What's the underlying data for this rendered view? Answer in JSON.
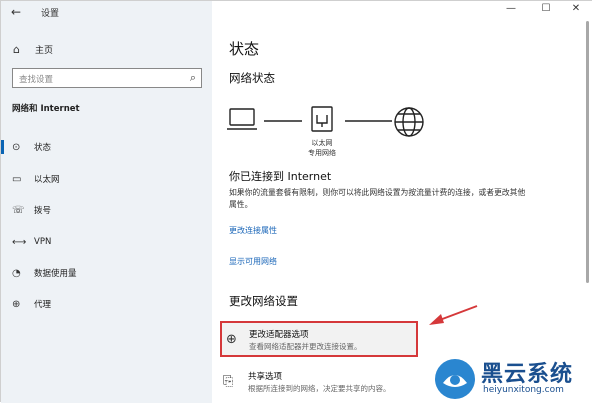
{
  "window": {
    "title": "设置",
    "back_glyph": "←",
    "minimize_glyph": "—",
    "maximize_glyph": "☐",
    "close_glyph": "✕"
  },
  "sidebar": {
    "home": {
      "icon": "home-icon",
      "glyph": "⌂",
      "label": "主页"
    },
    "search": {
      "placeholder": "查找设置",
      "icon": "search-icon",
      "glyph": "⌕"
    },
    "section_title": "网络和 Internet",
    "items": [
      {
        "icon": "status-icon",
        "glyph": "⊙",
        "label": "状态",
        "selected": true
      },
      {
        "icon": "ethernet-icon",
        "glyph": "▭",
        "label": "以太网",
        "selected": false
      },
      {
        "icon": "dialup-icon",
        "glyph": "☏",
        "label": "拨号",
        "selected": false
      },
      {
        "icon": "vpn-icon",
        "glyph": "⟷",
        "label": "VPN",
        "selected": false
      },
      {
        "icon": "data-usage-icon",
        "glyph": "◔",
        "label": "数据使用量",
        "selected": false
      },
      {
        "icon": "proxy-icon",
        "glyph": "⊕",
        "label": "代理",
        "selected": false
      }
    ]
  },
  "main": {
    "title": "状态",
    "network_status_title": "网络状态",
    "diagram_label_line1": "以太网",
    "diagram_label_line2": "专用网络",
    "connected_title": "你已连接到 Internet",
    "connected_desc": "如果你的流量套餐有限制，则你可以将此网络设置为按流量计费的连接，或者更改其他属性。",
    "link_change_props": "更改连接属性",
    "link_show_networks": "显示可用网络",
    "change_settings_title": "更改网络设置",
    "options": [
      {
        "icon": "adapter-icon",
        "glyph": "⊕",
        "title": "更改适配器选项",
        "subtitle": "查看网络适配器并更改连接设置。"
      },
      {
        "icon": "sharing-icon",
        "glyph": "⎘",
        "title": "共享选项",
        "subtitle": "根据所连接到的网络，决定要共享的内容。"
      }
    ]
  },
  "watermark": {
    "title": "黑云系统",
    "url": "heiyunxitong.com"
  },
  "colors": {
    "accent": "#0a64b4",
    "highlight_border": "#d5383a",
    "link": "#1a66b8",
    "annotation_arrow": "#d5383a"
  }
}
